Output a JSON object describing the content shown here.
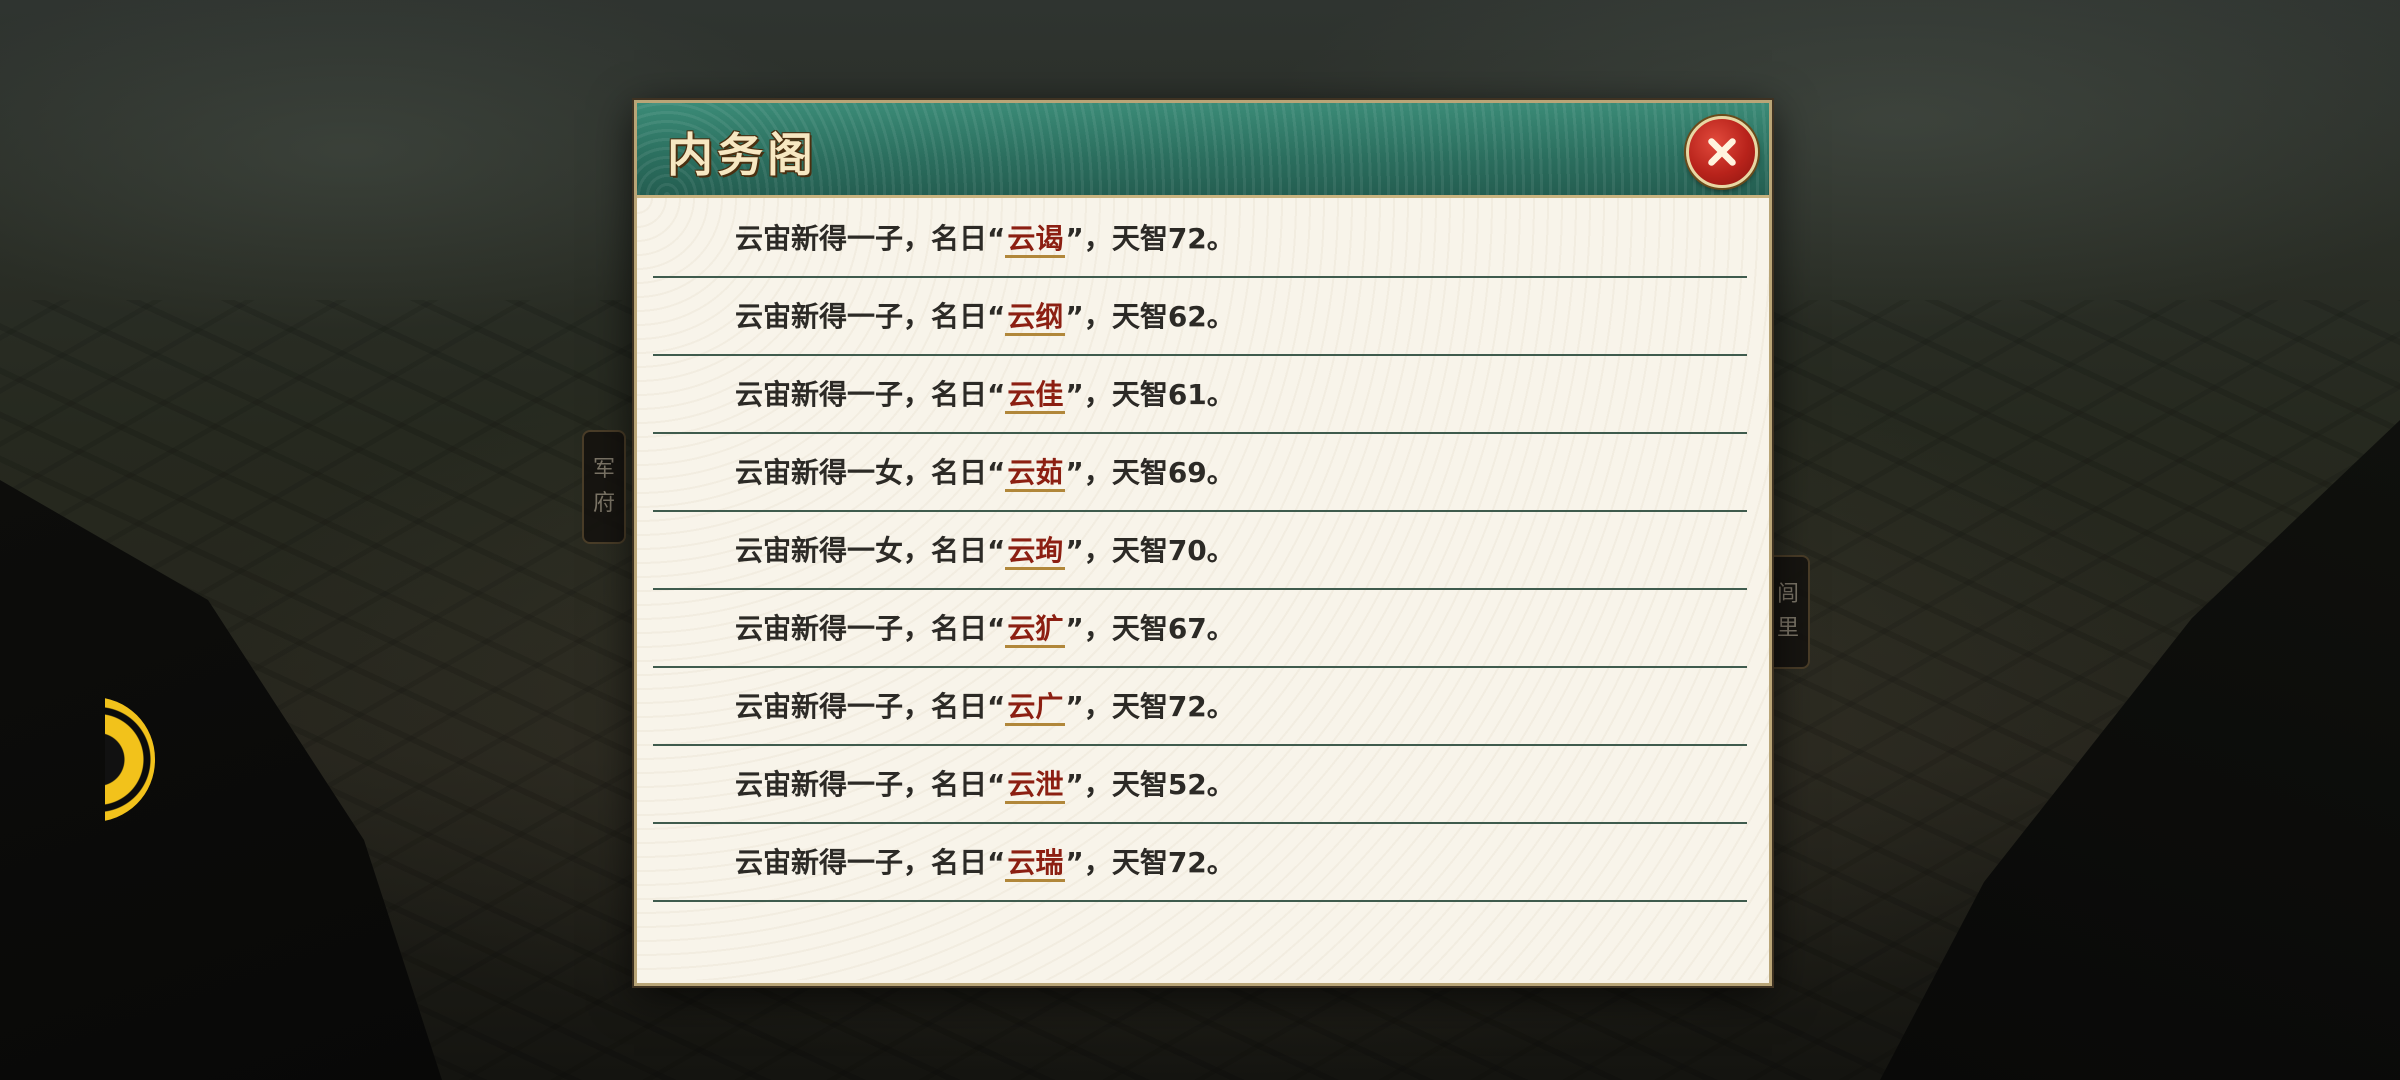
{
  "background": {
    "left_tag": [
      "军",
      "府"
    ],
    "right_tag": [
      "闾",
      "里"
    ]
  },
  "dialog": {
    "title": "内务阁",
    "close_icon": "close-x-icon",
    "rows": [
      {
        "prefix": "云宙新得一子，名日“",
        "name": "云谒",
        "suffix": "”，天智72。"
      },
      {
        "prefix": "云宙新得一子，名日“",
        "name": "云纲",
        "suffix": "”，天智62。"
      },
      {
        "prefix": "云宙新得一子，名日“",
        "name": "云佳",
        "suffix": "”，天智61。"
      },
      {
        "prefix": "云宙新得一女，名日“",
        "name": "云茹",
        "suffix": "”，天智69。"
      },
      {
        "prefix": "云宙新得一女，名日“",
        "name": "云珣",
        "suffix": "”，天智70。"
      },
      {
        "prefix": "云宙新得一子，名日“",
        "name": "云犷",
        "suffix": "”，天智67。"
      },
      {
        "prefix": "云宙新得一子，名日“",
        "name": "云广",
        "suffix": "”，天智72。"
      },
      {
        "prefix": "云宙新得一子，名日“",
        "name": "云泄",
        "suffix": "”，天智52。"
      },
      {
        "prefix": "云宙新得一子，名日“",
        "name": "云瑞",
        "suffix": "”，天智72。"
      }
    ]
  },
  "colors": {
    "header_green": "#2b6e5e",
    "name_red": "#8c1f12",
    "close_red": "#b8231b",
    "accent_yellow": "#f2c21b"
  }
}
